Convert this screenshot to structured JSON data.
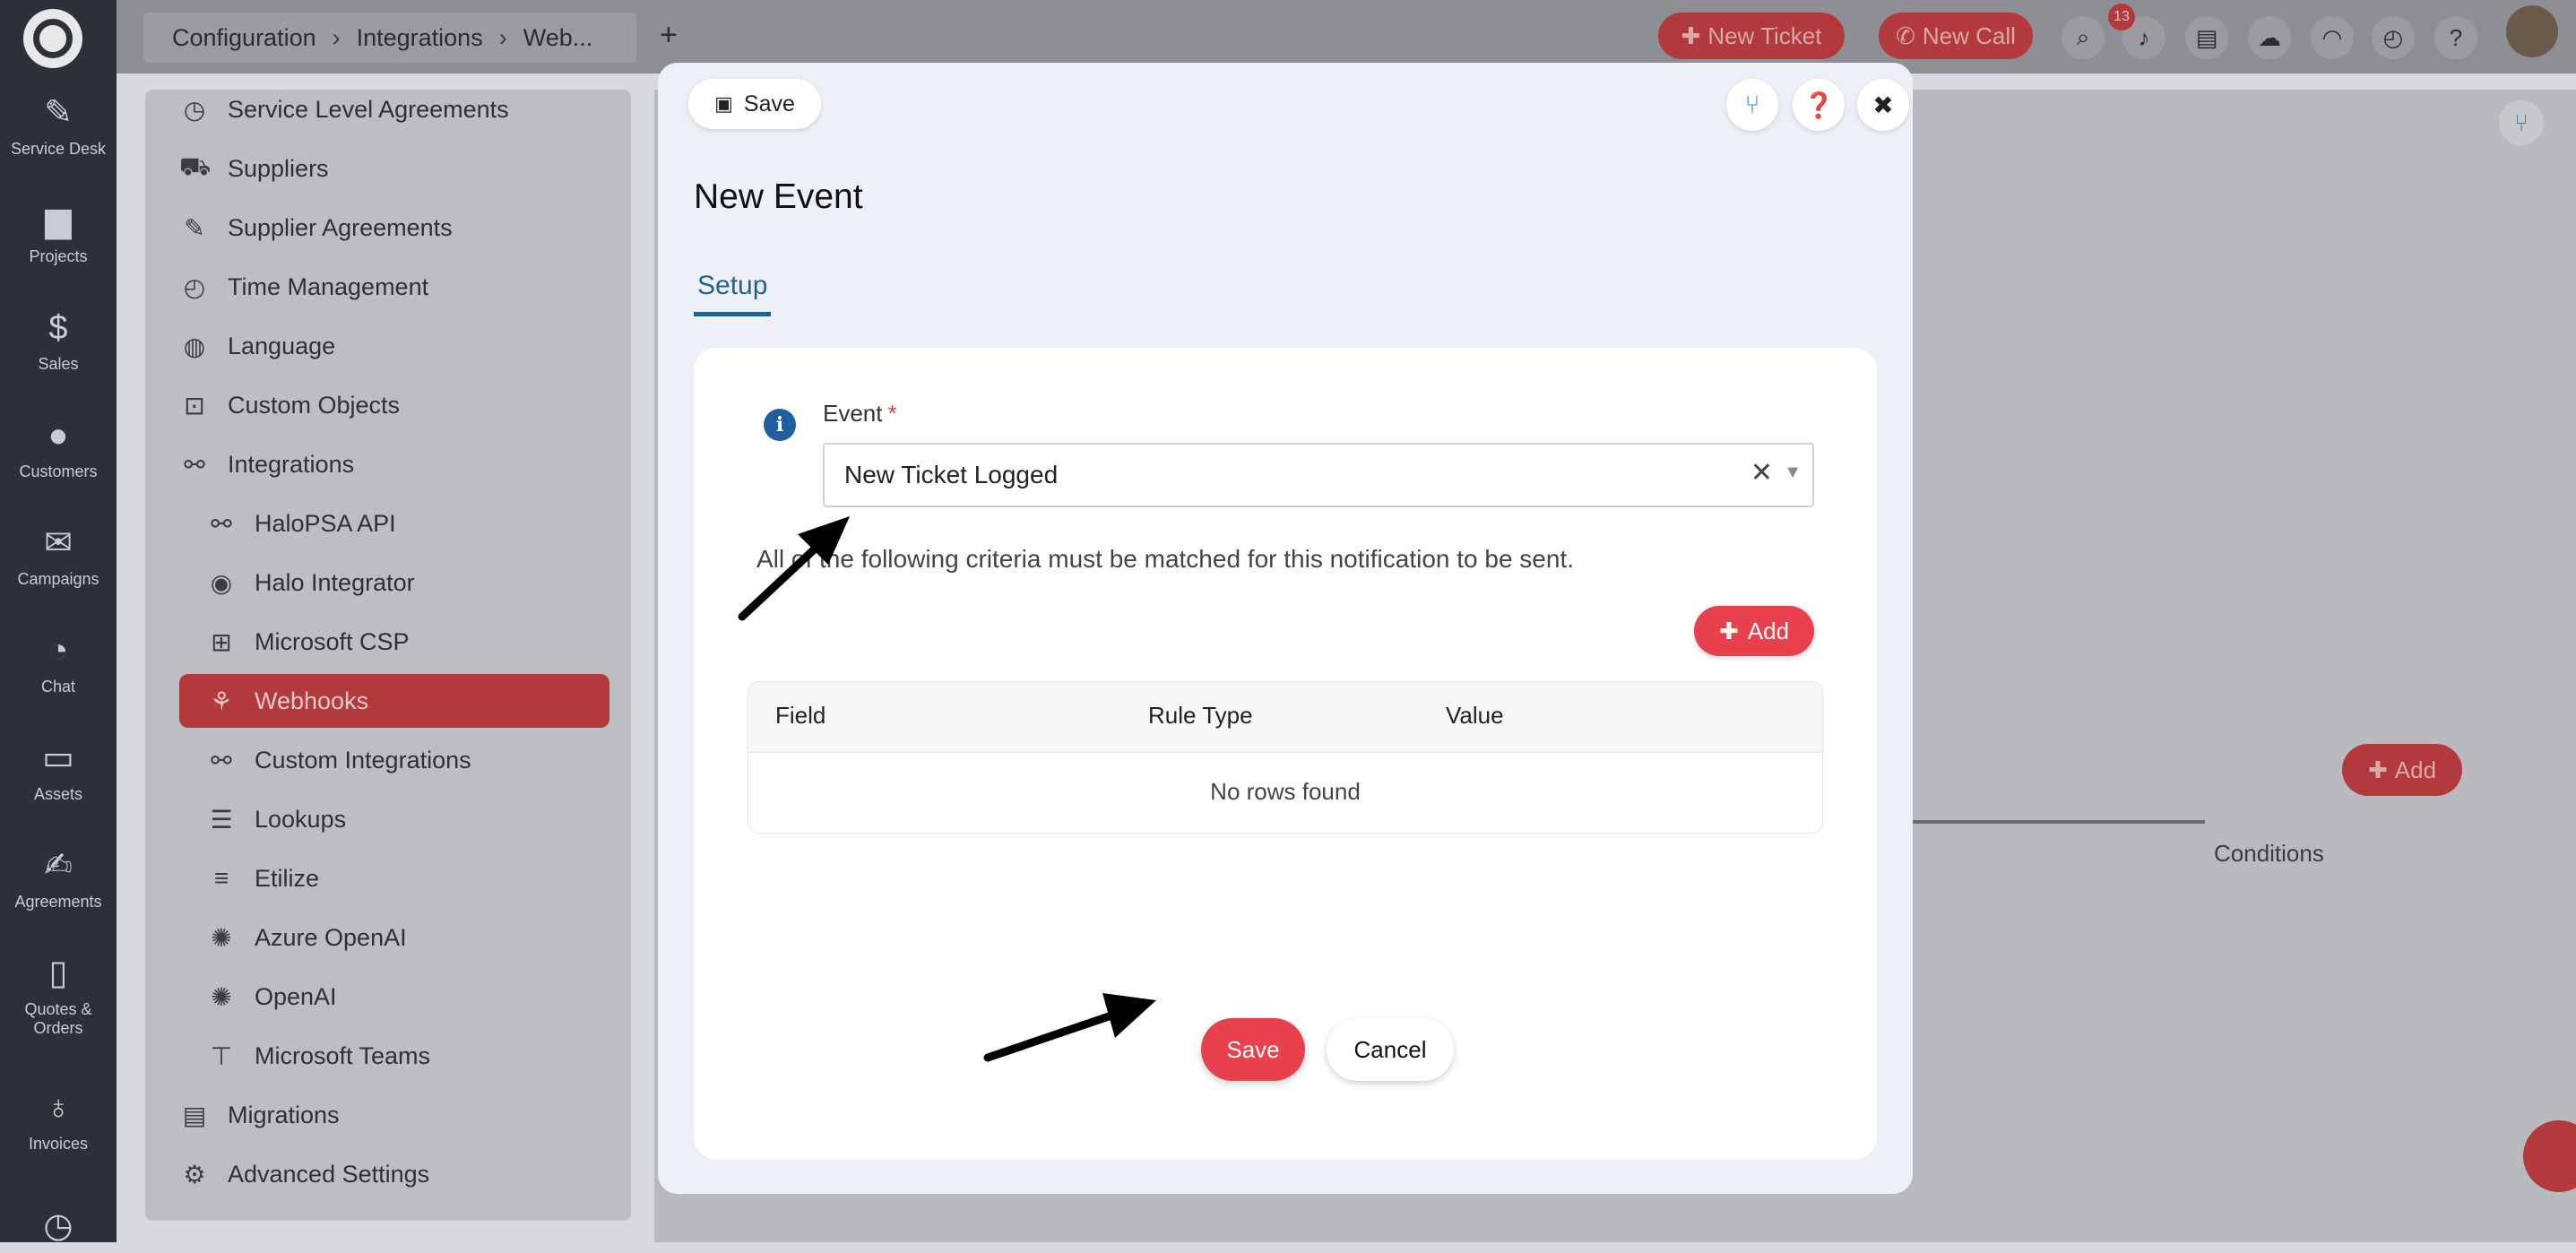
{
  "sidebar": {
    "items": [
      {
        "label": "Service Desk",
        "icon": "ticket-icon",
        "glyph": "✎"
      },
      {
        "label": "Projects",
        "icon": "briefcase-icon",
        "glyph": "▆"
      },
      {
        "label": "Sales",
        "icon": "dollar-icon",
        "glyph": "$"
      },
      {
        "label": "Customers",
        "icon": "user-icon",
        "glyph": "●"
      },
      {
        "label": "Campaigns",
        "icon": "envelope-icon",
        "glyph": "✉"
      },
      {
        "label": "Chat",
        "icon": "chat-icon",
        "glyph": "◔"
      },
      {
        "label": "Assets",
        "icon": "monitor-icon",
        "glyph": "▭"
      },
      {
        "label": "Agreements",
        "icon": "pen-icon",
        "glyph": "✍"
      },
      {
        "label": "Quotes &",
        "label2": "Orders",
        "icon": "document-icon",
        "glyph": "▯"
      },
      {
        "label": "Invoices",
        "icon": "moneybag-icon",
        "glyph": "♁"
      }
    ]
  },
  "header": {
    "breadcrumb": [
      "Configuration",
      "Integrations",
      "Web..."
    ],
    "new_ticket": "New Ticket",
    "new_call": "New Call",
    "notification_count": "13"
  },
  "config_menu": {
    "items": [
      {
        "label": "Service Level Agreements",
        "icon": "stopwatch-icon",
        "glyph": "◷"
      },
      {
        "label": "Suppliers",
        "icon": "truck-icon",
        "glyph": "⛟"
      },
      {
        "label": "Supplier Agreements",
        "icon": "edit-icon",
        "glyph": "✎"
      },
      {
        "label": "Time Management",
        "icon": "clock-icon",
        "glyph": "◴"
      },
      {
        "label": "Language",
        "icon": "globe-icon",
        "glyph": "◍"
      },
      {
        "label": "Custom Objects",
        "icon": "custom-object-icon",
        "glyph": "⊡"
      },
      {
        "label": "Integrations",
        "icon": "link-icon",
        "glyph": "⚯"
      },
      {
        "label": "HaloPSA API",
        "icon": "api-icon",
        "glyph": "⚯",
        "sub": true
      },
      {
        "label": "Halo Integrator",
        "icon": "halo-icon",
        "glyph": "◉",
        "sub": true
      },
      {
        "label": "Microsoft CSP",
        "icon": "windows-icon",
        "glyph": "⊞",
        "sub": true
      },
      {
        "label": "Webhooks",
        "icon": "webhook-icon",
        "glyph": "⚘",
        "sub": true,
        "active": true
      },
      {
        "label": "Custom Integrations",
        "icon": "link-icon",
        "glyph": "⚯",
        "sub": true
      },
      {
        "label": "Lookups",
        "icon": "database-icon",
        "glyph": "☰",
        "sub": true
      },
      {
        "label": "Etilize",
        "icon": "etilize-icon",
        "glyph": "≡",
        "sub": true
      },
      {
        "label": "Azure OpenAI",
        "icon": "openai-icon",
        "glyph": "✺",
        "sub": true
      },
      {
        "label": "OpenAI",
        "icon": "openai-icon",
        "glyph": "✺",
        "sub": true
      },
      {
        "label": "Microsoft Teams",
        "icon": "teams-icon",
        "glyph": "⊤",
        "sub": true
      },
      {
        "label": "Migrations",
        "icon": "folder-icon",
        "glyph": "▤"
      },
      {
        "label": "Advanced Settings",
        "icon": "gears-icon",
        "glyph": "⚙"
      }
    ]
  },
  "background": {
    "add_label": "Add",
    "conditions_label": "Conditions"
  },
  "modal": {
    "save_label": "Save",
    "title": "New Event",
    "tab": "Setup",
    "event_label": "Event",
    "required_mark": "*",
    "event_value": "New Ticket Logged",
    "criteria_text": "All of the following criteria must be matched for this notification to be sent.",
    "add_label": "Add",
    "table": {
      "columns": [
        "Field",
        "Rule Type",
        "Value"
      ],
      "empty_text": "No rows found"
    },
    "footer_save": "Save",
    "footer_cancel": "Cancel"
  },
  "colors": {
    "accent": "#e8404c",
    "link": "#23628f",
    "nav": "#2c3038"
  }
}
